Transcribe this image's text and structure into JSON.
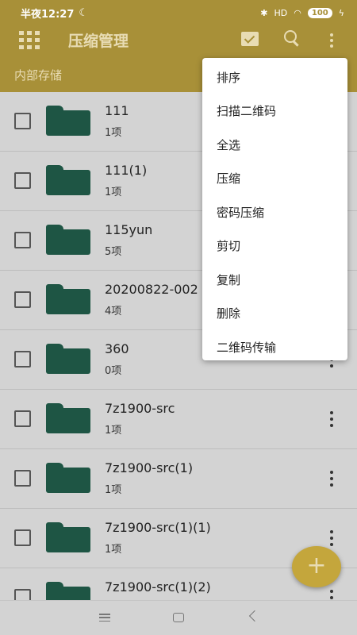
{
  "status_bar": {
    "time": "半夜12:27",
    "network": "HD",
    "battery": "100"
  },
  "app_bar": {
    "title": "压缩管理"
  },
  "breadcrumb": "内部存储",
  "files": [
    {
      "name": "111",
      "count": "1项"
    },
    {
      "name": "111(1)",
      "count": "1项"
    },
    {
      "name": "115yun",
      "count": "5项"
    },
    {
      "name": "20200822-002",
      "count": "4项"
    },
    {
      "name": "360",
      "count": "0项"
    },
    {
      "name": "7z1900-src",
      "count": "1项"
    },
    {
      "name": "7z1900-src(1)",
      "count": "1项"
    },
    {
      "name": "7z1900-src(1)(1)",
      "count": "1项"
    },
    {
      "name": "7z1900-src(1)(2)",
      "count": ""
    }
  ],
  "menu": {
    "items": [
      "排序",
      "扫描二维码",
      "全选",
      "压缩",
      "密码压缩",
      "剪切",
      "复制",
      "删除",
      "二维码传输"
    ]
  },
  "fab": {
    "label": "+"
  },
  "colors": {
    "app_bar": "#a89038",
    "folder": "#1e5544",
    "fab": "#c4a63c"
  }
}
